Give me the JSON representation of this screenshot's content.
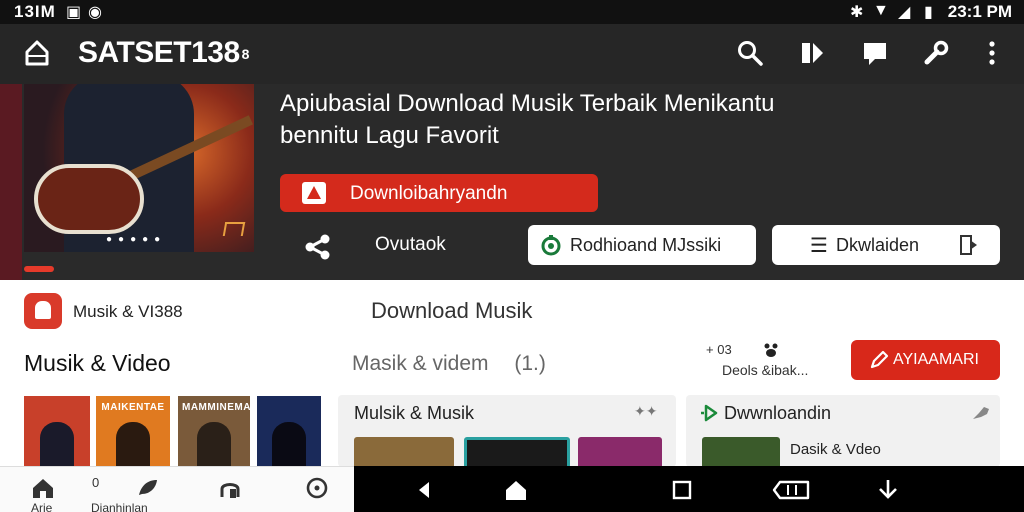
{
  "status_bar": {
    "time_left": "13IM",
    "time_right": "23:1 PM"
  },
  "app_bar": {
    "title": "SATSET138",
    "title_suffix": "8",
    "icons": [
      "home-icon",
      "search-icon",
      "bookmark-icon",
      "chat-icon",
      "wrench-icon",
      "more-vert-icon"
    ]
  },
  "hero": {
    "headline_line1": "Apiubasial Download Musik Terbaik Menikantu",
    "headline_line2": "bennitu Lagu Favorit",
    "download_button": "Downloibahryandn",
    "share_label": "Ovutaok",
    "pill_left": "Rodhioand MJssiki",
    "pill_right": "Dkwlaiden"
  },
  "section": {
    "badge_label": "Musik & VI388",
    "title": "Download Musik",
    "heading_left": "Musik & Video",
    "heading_mid": "Masik & videm",
    "heading_mid_count": "(1.)",
    "stat_top": "03",
    "stat_bottom": "Deols &ibak...",
    "cta_label": "AYIAAMARI"
  },
  "thumbnails": [
    {
      "caption": "",
      "bg": "#c8402a"
    },
    {
      "caption": "MAIKENTAE",
      "bg": "#e07a20"
    },
    {
      "caption": "MAMMINEMADA",
      "bg": "#7a5a3a"
    },
    {
      "caption": "",
      "bg": "#1a2a5a"
    }
  ],
  "cards": [
    {
      "title": "Mulsik & Musik"
    },
    {
      "title": "Dwwnloandin",
      "row": "Dasik & Vdeo"
    }
  ],
  "bottom_nav": {
    "items": [
      {
        "label": "Arie",
        "icon": "home-icon"
      },
      {
        "label": "Dianhinlan",
        "icon": "leaf-icon",
        "top_label": "0"
      },
      {
        "label": "",
        "icon": "headphones-icon"
      },
      {
        "label": "",
        "icon": "clock-icon"
      }
    ]
  },
  "colors": {
    "accent_red": "#d42a1c",
    "appbar_bg": "#262626",
    "status_bg": "#111111"
  }
}
